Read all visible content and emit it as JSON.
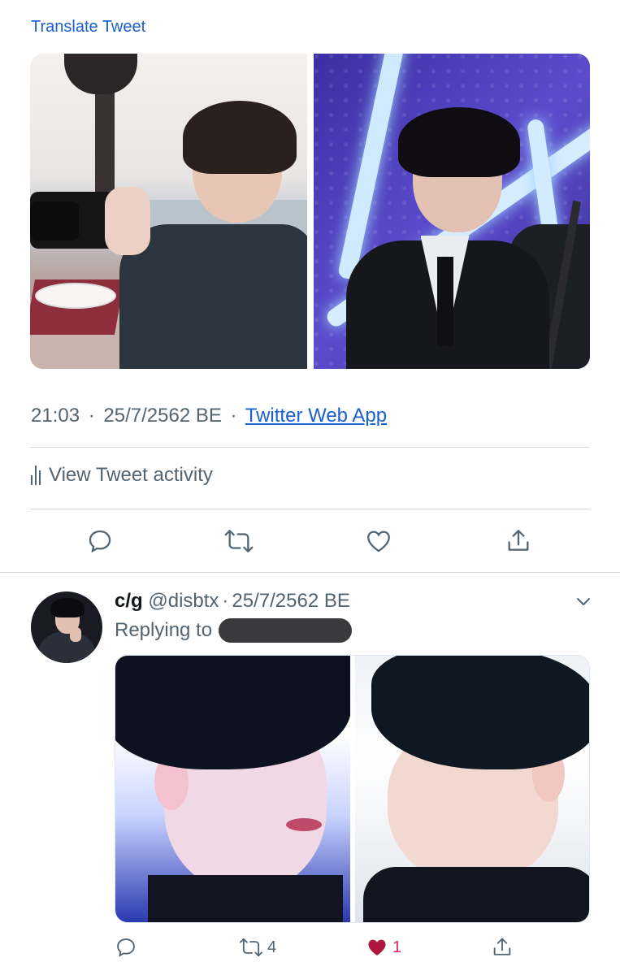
{
  "tweet": {
    "translate_label": "Translate Tweet",
    "time": "21:03",
    "date": "25/7/2562 BE",
    "separator": "·",
    "source": "Twitter Web App",
    "activity_label": "View Tweet activity",
    "actions": [
      "reply-icon",
      "retweet-icon",
      "like-icon",
      "share-icon"
    ]
  },
  "reply": {
    "name": "c/g",
    "handle": "@disbtx",
    "separator": "·",
    "date": "25/7/2562 BE",
    "replying_label": "Replying to",
    "retweet_count": "4",
    "like_count": "1"
  },
  "colors": {
    "link": "#1b5fd1",
    "secondary_text": "#536471",
    "like": "#e0245e",
    "divider": "#cfd9de"
  }
}
